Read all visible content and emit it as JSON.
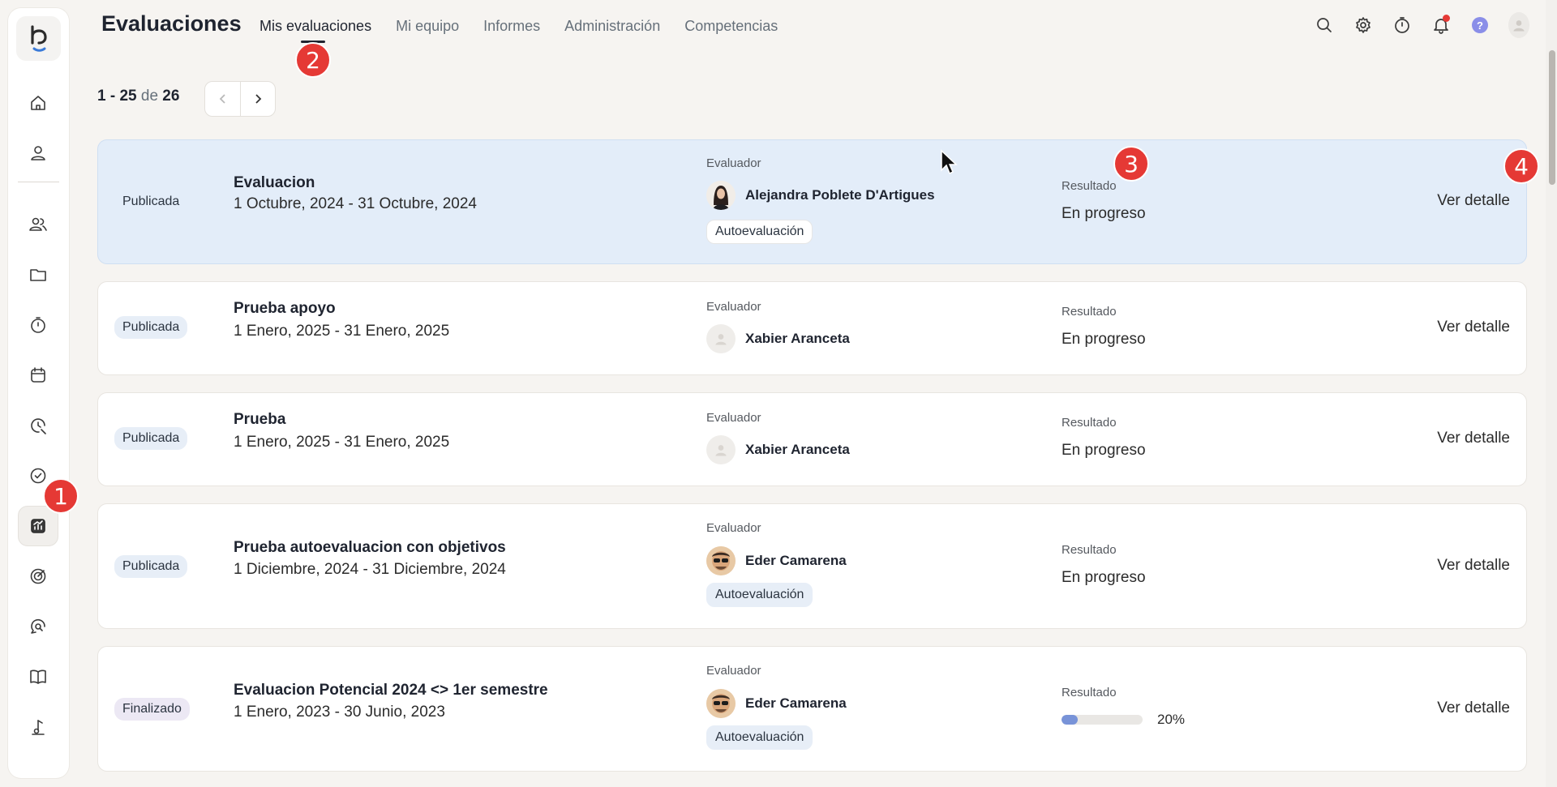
{
  "header": {
    "title": "Evaluaciones",
    "tabs": [
      {
        "label": "Mis evaluaciones",
        "active": true
      },
      {
        "label": "Mi equipo"
      },
      {
        "label": "Informes"
      },
      {
        "label": "Administración"
      },
      {
        "label": "Competencias"
      }
    ]
  },
  "sidebar": {
    "items": [
      {
        "icon": "home-icon"
      },
      {
        "icon": "user-icon"
      },
      {
        "icon": "users-icon"
      },
      {
        "icon": "folder-icon"
      },
      {
        "icon": "timer-icon"
      },
      {
        "icon": "calendar-icon"
      },
      {
        "icon": "time-history-icon"
      },
      {
        "icon": "check-circle-icon"
      },
      {
        "icon": "evaluations-chart-icon",
        "active": true
      },
      {
        "icon": "target-icon"
      },
      {
        "icon": "chat-search-icon"
      },
      {
        "icon": "book-icon"
      },
      {
        "icon": "music-note-icon"
      }
    ]
  },
  "pagination": {
    "range": "1 - 25",
    "de": "de",
    "total": "26"
  },
  "columns": {
    "evaluator_label": "Evaluador",
    "result_label": "Resultado",
    "detail_label": "Ver detalle"
  },
  "evaluations": [
    {
      "status": "Publicada",
      "title": "Evaluacion",
      "dates": "1 Octubre, 2024 - 31 Octubre, 2024",
      "evaluator": "Alejandra Poblete D'Artigues",
      "tag": "Autoevaluación",
      "result": "En progreso"
    },
    {
      "status": "Publicada",
      "title": "Prueba apoyo",
      "dates": "1 Enero, 2025 - 31 Enero, 2025",
      "evaluator": "Xabier Aranceta",
      "result": "En progreso"
    },
    {
      "status": "Publicada",
      "title": "Prueba",
      "dates": "1 Enero, 2025 - 31 Enero, 2025",
      "evaluator": "Xabier Aranceta",
      "result": "En progreso"
    },
    {
      "status": "Publicada",
      "title": "Prueba autoevaluacion con objetivos",
      "dates": "1 Diciembre, 2024 - 31 Diciembre, 2024",
      "evaluator": "Eder Camarena",
      "tag": "Autoevaluación",
      "result": "En progreso"
    },
    {
      "status": "Finalizado",
      "title": "Evaluacion Potencial 2024 <> 1er semestre",
      "dates": "1 Enero, 2023 - 30 Junio, 2023",
      "evaluator": "Eder Camarena",
      "tag": "Autoevaluación",
      "progress_fraction": 0.2,
      "progress_text": "20%"
    }
  ],
  "markers": [
    "1",
    "2",
    "3",
    "4"
  ],
  "colors": {
    "highlight_card": "#e3edf9",
    "marker": "#e53935",
    "progress": "#7893d8"
  }
}
